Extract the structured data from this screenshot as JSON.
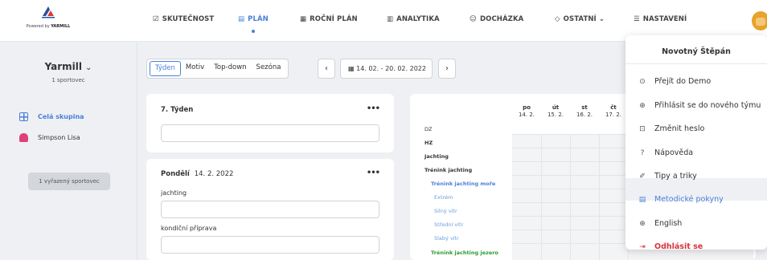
{
  "logo": {
    "powered_prefix": "Powered by",
    "powered_brand": "YARMILL"
  },
  "nav": [
    {
      "label": "SKUTEČNOST",
      "icon": "check-square-icon",
      "glyph": "☑"
    },
    {
      "label": "PLÁN",
      "icon": "list-icon",
      "glyph": "▤"
    },
    {
      "label": "ROČNÍ PLÁN",
      "icon": "calendar-icon",
      "glyph": "▦"
    },
    {
      "label": "ANALYTIKA",
      "icon": "bar-chart-icon",
      "glyph": "▥"
    },
    {
      "label": "DOCHÁZKA",
      "icon": "users-icon",
      "glyph": "☺"
    },
    {
      "label": "OSTATNÍ ⌄",
      "icon": "diamond-icon",
      "glyph": "◇"
    },
    {
      "label": "NASTAVENÍ",
      "icon": "sliders-icon",
      "glyph": "☰"
    }
  ],
  "sidebar": {
    "team_name": "Yarmill",
    "team_sub": "1 sportovec",
    "items": [
      {
        "label": "Celá skupina"
      },
      {
        "label": "Simpson Lisa"
      }
    ],
    "retired_button": "1 vyřazený sportovec"
  },
  "toolbar": {
    "views": [
      "Týden",
      "Motiv",
      "Top-down",
      "Sezóna"
    ],
    "prev": "‹",
    "next": "›",
    "date_range": "14. 02. - 20. 02. 2022"
  },
  "week_card": {
    "title": "7. Týden",
    "menu": "•••"
  },
  "day_card": {
    "day": "Pondělí",
    "date": "14. 2. 2022",
    "menu": "•••",
    "fields": [
      "jachting",
      "kondiční příprava"
    ]
  },
  "table": {
    "days": [
      {
        "name": "po",
        "date": "14. 2."
      },
      {
        "name": "út",
        "date": "15. 2."
      },
      {
        "name": "st",
        "date": "16. 2."
      },
      {
        "name": "čt",
        "date": "17. 2."
      }
    ],
    "rows": [
      {
        "label": "DZ",
        "style": ""
      },
      {
        "label": "HZ",
        "style": "b"
      },
      {
        "label": "Jachting",
        "style": "b"
      },
      {
        "label": "Trénink jachting",
        "style": "b"
      },
      {
        "label": "Trénink jachting moře",
        "style": "blue"
      },
      {
        "label": "Extrém",
        "style": "lblue"
      },
      {
        "label": "Silný vítr",
        "style": "lblue"
      },
      {
        "label": "Střední vítr",
        "style": "lblue"
      },
      {
        "label": "Slabý vítr",
        "style": "lblue"
      },
      {
        "label": "Trénink jachting jezero",
        "style": "green"
      }
    ]
  },
  "user_menu": {
    "name": "Novotný Štěpán",
    "items": [
      {
        "label": "Přejít do Demo",
        "icon": "arrow-circle-icon",
        "glyph": "⊙"
      },
      {
        "label": "Přihlásit se do nového týmu",
        "icon": "plus-circle-icon",
        "glyph": "⊕"
      },
      {
        "label": "Změnit heslo",
        "icon": "lock-icon",
        "glyph": "⊡"
      },
      {
        "label": "Nápověda",
        "icon": "help-icon",
        "glyph": "?"
      },
      {
        "label": "Tipy a triky",
        "icon": "rocket-icon",
        "glyph": "✐"
      },
      {
        "label": "Metodické pokyny",
        "icon": "document-icon",
        "glyph": "▤"
      },
      {
        "label": "English",
        "icon": "globe-icon",
        "glyph": "⊕"
      },
      {
        "label": "Odhlásit se",
        "icon": "logout-icon",
        "glyph": "⇥"
      }
    ]
  }
}
